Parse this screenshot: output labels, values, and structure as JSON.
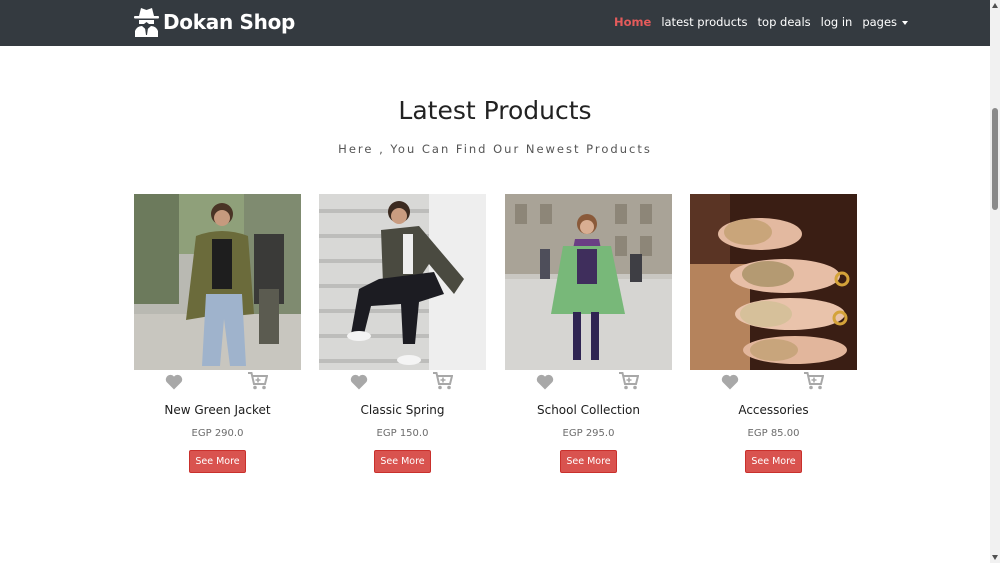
{
  "navbar": {
    "brand": "Dokan Shop",
    "brand_icon": "spy-icon",
    "links": [
      {
        "label": "Home",
        "active": true
      },
      {
        "label": "latest products"
      },
      {
        "label": "top deals"
      },
      {
        "label": "log in"
      },
      {
        "label": "pages",
        "dropdown": true
      }
    ]
  },
  "section": {
    "title": "Latest Products",
    "subtitle": "Here , You Can Find Our Newest Products"
  },
  "products": [
    {
      "title": "New Green Jacket",
      "price": "EGP 290.0",
      "button": "See More"
    },
    {
      "title": "Classic Spring",
      "price": "EGP 150.0",
      "button": "See More"
    },
    {
      "title": "School Collection",
      "price": "EGP 295.0",
      "button": "See More"
    },
    {
      "title": "Accessories",
      "price": "EGP 85.00",
      "button": "See More"
    }
  ],
  "colors": {
    "navbar_bg": "#343a40",
    "active_link": "#e45b5b",
    "button": "#d9534f",
    "icon_gray": "#a8a8a8"
  }
}
